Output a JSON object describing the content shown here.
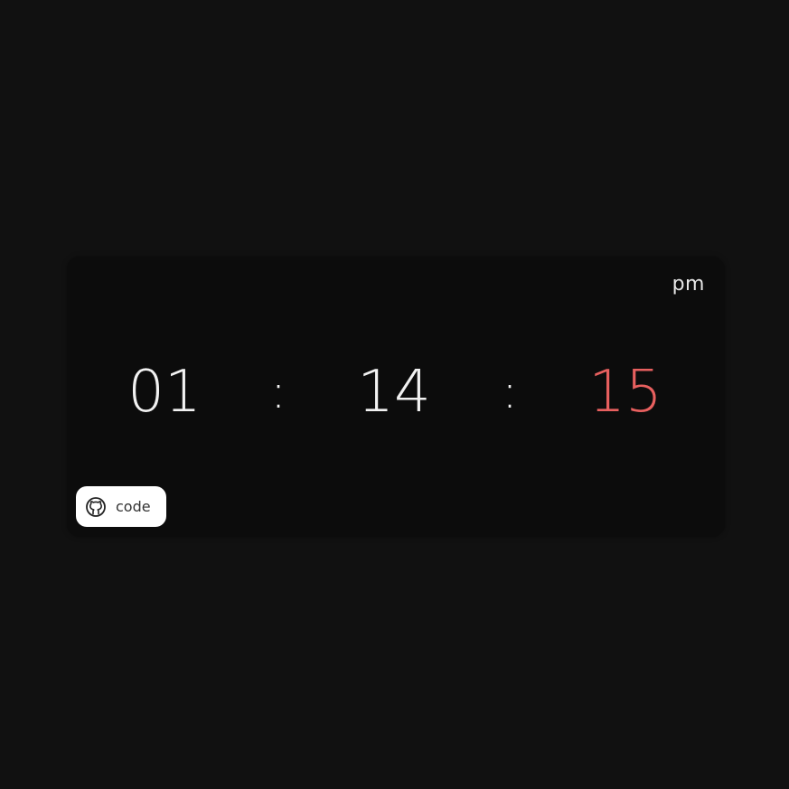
{
  "clock": {
    "hours": "01",
    "separator": ":",
    "minutes": "14",
    "seconds": "15",
    "period": "pm"
  },
  "code_button": {
    "label": "code",
    "icon": "github-icon"
  },
  "colors": {
    "background": "#111111",
    "card": "#0c0c0c",
    "digits": "#f2f2f2",
    "seconds_accent": "#e8605f",
    "button_bg": "#ffffff"
  }
}
